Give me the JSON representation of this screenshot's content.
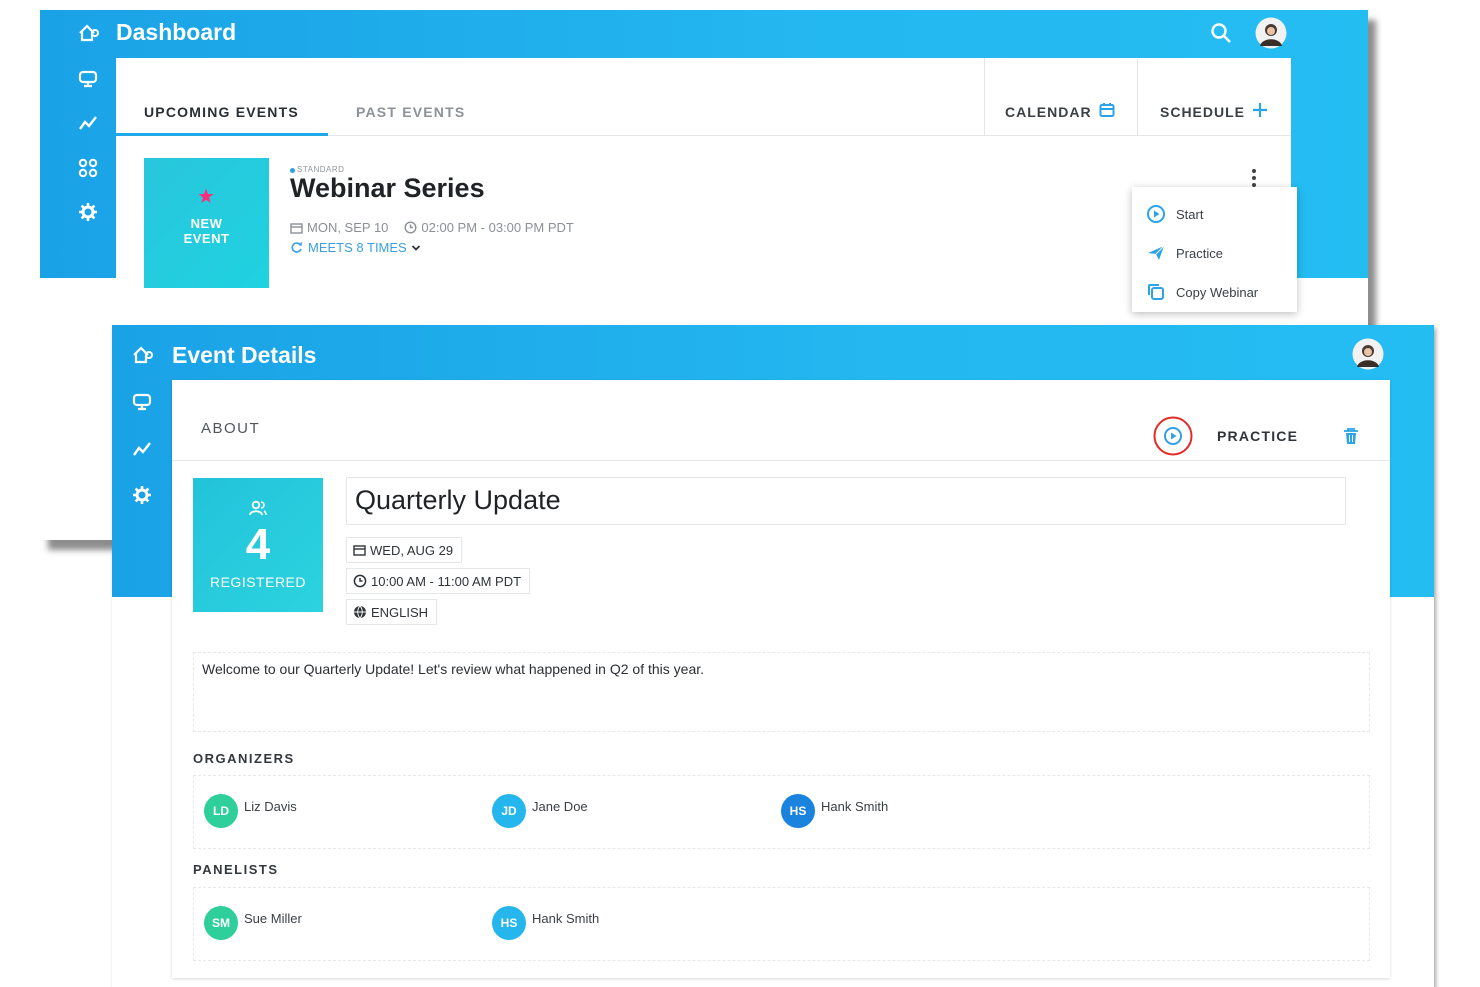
{
  "dashboard": {
    "title": "Dashboard",
    "tabs": [
      {
        "label": "UPCOMING EVENTS",
        "active": true
      },
      {
        "label": "PAST EVENTS",
        "active": false
      }
    ],
    "calendar_label": "CALENDAR",
    "schedule_label": "SCHEDULE",
    "event": {
      "thumb_line1": "NEW",
      "thumb_line2": "EVENT",
      "type_label": "STANDARD",
      "title": "Webinar Series",
      "date": "MON, SEP 10",
      "time": "02:00 PM - 03:00 PM PDT",
      "recurrence": "MEETS 8 TIMES"
    },
    "menu": [
      {
        "label": "Start",
        "icon": "play-circle-icon"
      },
      {
        "label": "Practice",
        "icon": "paper-plane-icon"
      },
      {
        "label": "Copy Webinar",
        "icon": "copy-icon"
      }
    ]
  },
  "details": {
    "title": "Event Details",
    "about_label": "ABOUT",
    "practice_label": "PRACTICE",
    "registered_count": "4",
    "registered_label": "REGISTERED",
    "event_title": "Quarterly Update",
    "date": "WED, AUG 29",
    "time": "10:00 AM - 11:00 AM PDT",
    "language": "ENGLISH",
    "description": "Welcome to our Quarterly Update! Let's review what happened in Q2 of this year.",
    "organizers_label": "ORGANIZERS",
    "organizers": [
      {
        "initials": "LD",
        "name": "Liz Davis",
        "color": "#2ecf9a"
      },
      {
        "initials": "JD",
        "name": "Jane Doe",
        "color": "#25b6ee"
      },
      {
        "initials": "HS",
        "name": "Hank Smith",
        "color": "#1a83dd"
      }
    ],
    "panelists_label": "PANELISTS",
    "panelists": [
      {
        "initials": "SM",
        "name": "Sue Miller",
        "color": "#2ecf9a"
      },
      {
        "initials": "HS",
        "name": "Hank Smith",
        "color": "#25b6ee"
      }
    ]
  },
  "colors": {
    "header_blue": "#24b8f0",
    "accent_blue": "#21a8e8",
    "teal_tile": "#29c6dc",
    "star_pink": "#ff2d7a",
    "focus_ring": "#e22b2b"
  }
}
